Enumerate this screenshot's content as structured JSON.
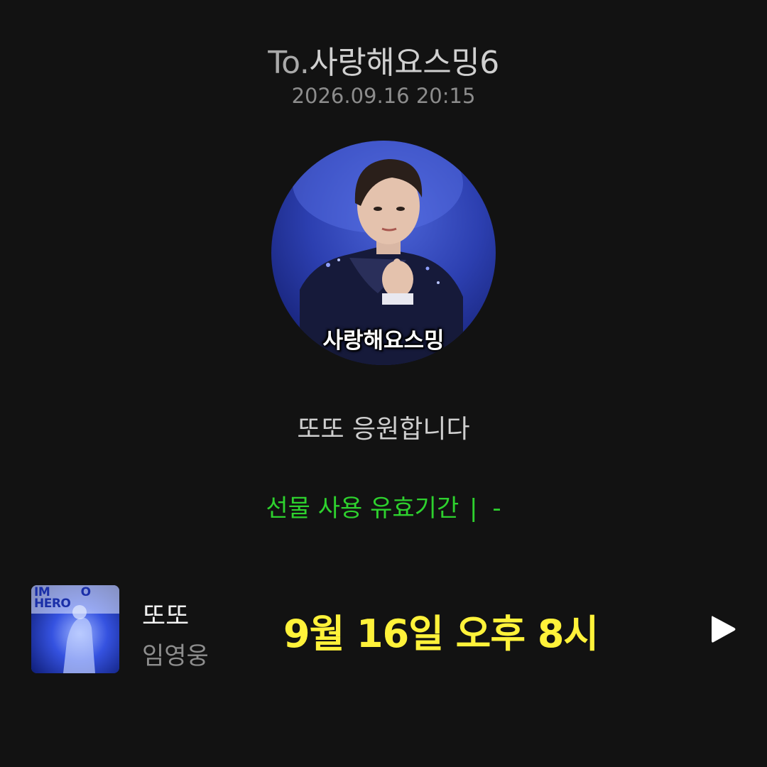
{
  "header": {
    "recipient_prefix": "To.",
    "recipient_name": "사랑해요스밍6",
    "timestamp": "2026.09.16 20:15"
  },
  "profile": {
    "caption": "사랑해요스밍"
  },
  "gift": {
    "message": "또또 응원합니다",
    "validity_label": "선물 사용 유효기간",
    "validity_separator": "|",
    "validity_value": "-",
    "validity_color": "#2ed12e"
  },
  "track": {
    "album_art_text": "IM\nHERO",
    "title": "또또",
    "artist": "임영웅",
    "overlay_text": "9월 16일 오후 8시",
    "overlay_color": "#fff23a",
    "play_icon": "play-icon"
  }
}
